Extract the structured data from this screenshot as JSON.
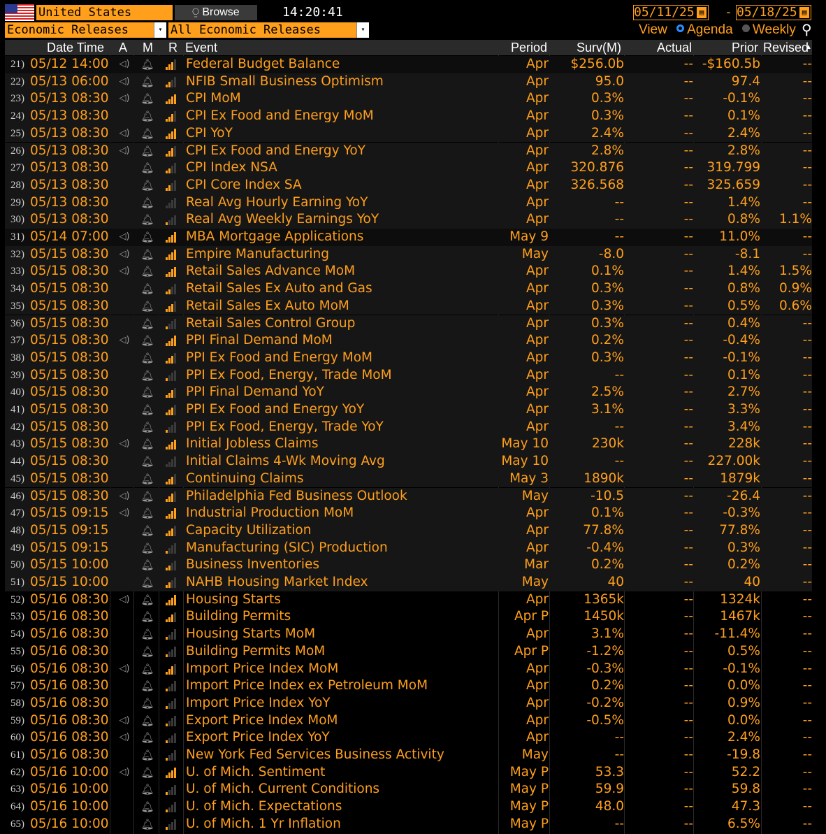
{
  "header": {
    "country": "United States",
    "browse_label": "Browse",
    "time": "14:20:41",
    "date_from": "05/11/25",
    "date_sep": "-",
    "date_to": "05/18/25",
    "category": "Economic Releases",
    "subcategory": "All Economic Releases",
    "view_label": "View",
    "view_agenda": "Agenda",
    "view_weekly": "Weekly"
  },
  "columns": {
    "datetime": "Date Time",
    "a": "A",
    "m": "M",
    "r": "R",
    "event": "Event",
    "period": "Period",
    "surv": "Surv(M)",
    "actual": "Actual",
    "prior": "Prior",
    "revised": "Revised"
  },
  "colors": {
    "accent": "#ff9f1c",
    "bar_on": "#ff9f1c",
    "bar_off": "#3a3a3a",
    "selected_radio": "#2b8cff"
  },
  "rows": [
    {
      "n": "21)",
      "dt": "05/12 14:00",
      "a": true,
      "r": 3,
      "event": "Federal Budget Balance",
      "period": "Apr",
      "surv": "$256.0b",
      "actual": "--",
      "prior": "-$160.5b",
      "revised": "--",
      "band": "sel"
    },
    {
      "n": "22)",
      "dt": "05/13 06:00",
      "a": true,
      "r": 2,
      "event": "NFIB Small Business Optimism",
      "period": "Apr",
      "surv": "95.0",
      "actual": "--",
      "prior": "97.4",
      "revised": "--",
      "band": "b"
    },
    {
      "n": "23)",
      "dt": "05/13 08:30",
      "a": true,
      "r": 4,
      "event": "CPI MoM",
      "period": "Apr",
      "surv": "0.3%",
      "actual": "--",
      "prior": "-0.1%",
      "revised": "--",
      "band": "b"
    },
    {
      "n": "24)",
      "dt": "05/13 08:30",
      "a": false,
      "r": 3,
      "event": "CPI Ex Food and Energy MoM",
      "period": "Apr",
      "surv": "0.3%",
      "actual": "--",
      "prior": "0.1%",
      "revised": "--",
      "band": "b"
    },
    {
      "n": "25)",
      "dt": "05/13 08:30",
      "a": true,
      "r": 4,
      "event": "CPI YoY",
      "period": "Apr",
      "surv": "2.4%",
      "actual": "--",
      "prior": "2.4%",
      "revised": "--",
      "band": "b"
    },
    {
      "n": "26)",
      "dt": "05/13 08:30",
      "a": true,
      "r": 3,
      "event": "CPI Ex Food and Energy YoY",
      "period": "Apr",
      "surv": "2.8%",
      "actual": "--",
      "prior": "2.8%",
      "revised": "--",
      "band": "b"
    },
    {
      "n": "27)",
      "dt": "05/13 08:30",
      "a": false,
      "r": 2,
      "event": "CPI Index NSA",
      "period": "Apr",
      "surv": "320.876",
      "actual": "--",
      "prior": "319.799",
      "revised": "--",
      "band": "b"
    },
    {
      "n": "28)",
      "dt": "05/13 08:30",
      "a": false,
      "r": 2,
      "event": "CPI Core Index SA",
      "period": "Apr",
      "surv": "326.568",
      "actual": "--",
      "prior": "325.659",
      "revised": "--",
      "band": "b"
    },
    {
      "n": "29)",
      "dt": "05/13 08:30",
      "a": false,
      "r": 0,
      "event": "Real Avg Hourly Earning YoY",
      "period": "Apr",
      "surv": "--",
      "actual": "--",
      "prior": "1.4%",
      "revised": "--",
      "band": "b"
    },
    {
      "n": "30)",
      "dt": "05/13 08:30",
      "a": false,
      "r": 1,
      "event": "Real Avg Weekly Earnings YoY",
      "period": "Apr",
      "surv": "--",
      "actual": "--",
      "prior": "0.8%",
      "revised": "1.1%",
      "band": "b"
    },
    {
      "n": "31)",
      "dt": "05/14 07:00",
      "a": true,
      "r": 4,
      "event": "MBA Mortgage Applications",
      "period": "May 9",
      "surv": "--",
      "actual": "--",
      "prior": "11.0%",
      "revised": "--",
      "band": "sel"
    },
    {
      "n": "32)",
      "dt": "05/15 08:30",
      "a": true,
      "r": 4,
      "event": "Empire Manufacturing",
      "period": "May",
      "surv": "-8.0",
      "actual": "--",
      "prior": "-8.1",
      "revised": "--",
      "band": "b"
    },
    {
      "n": "33)",
      "dt": "05/15 08:30",
      "a": true,
      "r": 4,
      "event": "Retail Sales Advance MoM",
      "period": "Apr",
      "surv": "0.1%",
      "actual": "--",
      "prior": "1.4%",
      "revised": "1.5%",
      "band": "b"
    },
    {
      "n": "34)",
      "dt": "05/15 08:30",
      "a": false,
      "r": 2,
      "event": "Retail Sales Ex Auto and Gas",
      "period": "Apr",
      "surv": "0.3%",
      "actual": "--",
      "prior": "0.8%",
      "revised": "0.9%",
      "band": "b"
    },
    {
      "n": "35)",
      "dt": "05/15 08:30",
      "a": false,
      "r": 3,
      "event": "Retail Sales Ex Auto MoM",
      "period": "Apr",
      "surv": "0.3%",
      "actual": "--",
      "prior": "0.5%",
      "revised": "0.6%",
      "band": "b"
    },
    {
      "n": "36)",
      "dt": "05/15 08:30",
      "a": false,
      "r": 1,
      "event": "Retail Sales Control Group",
      "period": "Apr",
      "surv": "0.3%",
      "actual": "--",
      "prior": "0.4%",
      "revised": "--",
      "band": "b"
    },
    {
      "n": "37)",
      "dt": "05/15 08:30",
      "a": true,
      "r": 4,
      "event": "PPI Final Demand MoM",
      "period": "Apr",
      "surv": "0.2%",
      "actual": "--",
      "prior": "-0.4%",
      "revised": "--",
      "band": "b"
    },
    {
      "n": "38)",
      "dt": "05/15 08:30",
      "a": false,
      "r": 3,
      "event": "PPI Ex Food and Energy MoM",
      "period": "Apr",
      "surv": "0.3%",
      "actual": "--",
      "prior": "-0.1%",
      "revised": "--",
      "band": "b"
    },
    {
      "n": "39)",
      "dt": "05/15 08:30",
      "a": false,
      "r": 1,
      "event": "PPI Ex Food, Energy, Trade MoM",
      "period": "Apr",
      "surv": "--",
      "actual": "--",
      "prior": "0.1%",
      "revised": "--",
      "band": "b"
    },
    {
      "n": "40)",
      "dt": "05/15 08:30",
      "a": false,
      "r": 3,
      "event": "PPI Final Demand YoY",
      "period": "Apr",
      "surv": "2.5%",
      "actual": "--",
      "prior": "2.7%",
      "revised": "--",
      "band": "b"
    },
    {
      "n": "41)",
      "dt": "05/15 08:30",
      "a": false,
      "r": 3,
      "event": "PPI Ex Food and Energy YoY",
      "period": "Apr",
      "surv": "3.1%",
      "actual": "--",
      "prior": "3.3%",
      "revised": "--",
      "band": "b"
    },
    {
      "n": "42)",
      "dt": "05/15 08:30",
      "a": false,
      "r": 1,
      "event": "PPI Ex Food, Energy, Trade YoY",
      "period": "Apr",
      "surv": "--",
      "actual": "--",
      "prior": "3.4%",
      "revised": "--",
      "band": "b"
    },
    {
      "n": "43)",
      "dt": "05/15 08:30",
      "a": true,
      "r": 4,
      "event": "Initial Jobless Claims",
      "period": "May 10",
      "surv": "230k",
      "actual": "--",
      "prior": "228k",
      "revised": "--",
      "band": "b"
    },
    {
      "n": "44)",
      "dt": "05/15 08:30",
      "a": false,
      "r": 0,
      "event": "Initial Claims 4-Wk Moving Avg",
      "period": "May 10",
      "surv": "--",
      "actual": "--",
      "prior": "227.00k",
      "revised": "--",
      "band": "b"
    },
    {
      "n": "45)",
      "dt": "05/15 08:30",
      "a": false,
      "r": 3,
      "event": "Continuing Claims",
      "period": "May 3",
      "surv": "1890k",
      "actual": "--",
      "prior": "1879k",
      "revised": "--",
      "band": "b"
    },
    {
      "n": "46)",
      "dt": "05/15 08:30",
      "a": true,
      "r": 3,
      "event": "Philadelphia Fed Business Outlook",
      "period": "May",
      "surv": "-10.5",
      "actual": "--",
      "prior": "-26.4",
      "revised": "--",
      "band": "b"
    },
    {
      "n": "47)",
      "dt": "05/15 09:15",
      "a": true,
      "r": 4,
      "event": "Industrial Production MoM",
      "period": "Apr",
      "surv": "0.1%",
      "actual": "--",
      "prior": "-0.3%",
      "revised": "--",
      "band": "b"
    },
    {
      "n": "48)",
      "dt": "05/15 09:15",
      "a": false,
      "r": 3,
      "event": "Capacity Utilization",
      "period": "Apr",
      "surv": "77.8%",
      "actual": "--",
      "prior": "77.8%",
      "revised": "--",
      "band": "b"
    },
    {
      "n": "49)",
      "dt": "05/15 09:15",
      "a": false,
      "r": 1,
      "event": "Manufacturing (SIC) Production",
      "period": "Apr",
      "surv": "-0.4%",
      "actual": "--",
      "prior": "0.3%",
      "revised": "--",
      "band": "b"
    },
    {
      "n": "50)",
      "dt": "05/15 10:00",
      "a": false,
      "r": 2,
      "event": "Business Inventories",
      "period": "Mar",
      "surv": "0.2%",
      "actual": "--",
      "prior": "0.2%",
      "revised": "--",
      "band": "b"
    },
    {
      "n": "51)",
      "dt": "05/15 10:00",
      "a": false,
      "r": 2,
      "event": "NAHB Housing Market Index",
      "period": "May",
      "surv": "40",
      "actual": "--",
      "prior": "40",
      "revised": "--",
      "band": "b"
    },
    {
      "n": "52)",
      "dt": "05/16 08:30",
      "a": true,
      "r": 4,
      "event": "Housing Starts",
      "period": "Apr",
      "surv": "1365k",
      "actual": "--",
      "prior": "1324k",
      "revised": "--",
      "band": "n"
    },
    {
      "n": "53)",
      "dt": "05/16 08:30",
      "a": false,
      "r": 3,
      "event": "Building Permits",
      "period": "Apr P",
      "surv": "1450k",
      "actual": "--",
      "prior": "1467k",
      "revised": "--",
      "band": "n"
    },
    {
      "n": "54)",
      "dt": "05/16 08:30",
      "a": false,
      "r": 1,
      "event": "Housing Starts MoM",
      "period": "Apr",
      "surv": "3.1%",
      "actual": "--",
      "prior": "-11.4%",
      "revised": "--",
      "band": "n"
    },
    {
      "n": "55)",
      "dt": "05/16 08:30",
      "a": false,
      "r": 1,
      "event": "Building Permits MoM",
      "period": "Apr P",
      "surv": "-1.2%",
      "actual": "--",
      "prior": "0.5%",
      "revised": "--",
      "band": "n"
    },
    {
      "n": "56)",
      "dt": "05/16 08:30",
      "a": true,
      "r": 3,
      "event": "Import Price Index MoM",
      "period": "Apr",
      "surv": "-0.3%",
      "actual": "--",
      "prior": "-0.1%",
      "revised": "--",
      "band": "n"
    },
    {
      "n": "57)",
      "dt": "05/16 08:30",
      "a": false,
      "r": 1,
      "event": "Import Price Index ex Petroleum MoM",
      "period": "Apr",
      "surv": "0.2%",
      "actual": "--",
      "prior": "0.0%",
      "revised": "--",
      "band": "n"
    },
    {
      "n": "58)",
      "dt": "05/16 08:30",
      "a": false,
      "r": 1,
      "event": "Import Price Index YoY",
      "period": "Apr",
      "surv": "-0.2%",
      "actual": "--",
      "prior": "0.9%",
      "revised": "--",
      "band": "n"
    },
    {
      "n": "59)",
      "dt": "05/16 08:30",
      "a": true,
      "r": 1,
      "event": "Export Price Index MoM",
      "period": "Apr",
      "surv": "-0.5%",
      "actual": "--",
      "prior": "0.0%",
      "revised": "--",
      "band": "n"
    },
    {
      "n": "60)",
      "dt": "05/16 08:30",
      "a": true,
      "r": 1,
      "event": "Export Price Index YoY",
      "period": "Apr",
      "surv": "--",
      "actual": "--",
      "prior": "2.4%",
      "revised": "--",
      "band": "n"
    },
    {
      "n": "61)",
      "dt": "05/16 08:30",
      "a": false,
      "r": 1,
      "event": "New York Fed Services Business Activity",
      "period": "May",
      "surv": "--",
      "actual": "--",
      "prior": "-19.8",
      "revised": "--",
      "band": "n"
    },
    {
      "n": "62)",
      "dt": "05/16 10:00",
      "a": true,
      "r": 4,
      "event": "U. of Mich. Sentiment",
      "period": "May P",
      "surv": "53.3",
      "actual": "--",
      "prior": "52.2",
      "revised": "--",
      "band": "n"
    },
    {
      "n": "63)",
      "dt": "05/16 10:00",
      "a": false,
      "r": 1,
      "event": "U. of Mich. Current Conditions",
      "period": "May P",
      "surv": "59.9",
      "actual": "--",
      "prior": "59.8",
      "revised": "--",
      "band": "n"
    },
    {
      "n": "64)",
      "dt": "05/16 10:00",
      "a": false,
      "r": 1,
      "event": "U. of Mich. Expectations",
      "period": "May P",
      "surv": "48.0",
      "actual": "--",
      "prior": "47.3",
      "revised": "--",
      "band": "n"
    },
    {
      "n": "65)",
      "dt": "05/16 10:00",
      "a": false,
      "r": 1,
      "event": "U. of Mich. 1 Yr Inflation",
      "period": "May P",
      "surv": "--",
      "actual": "--",
      "prior": "6.5%",
      "revised": "--",
      "band": "n"
    }
  ]
}
